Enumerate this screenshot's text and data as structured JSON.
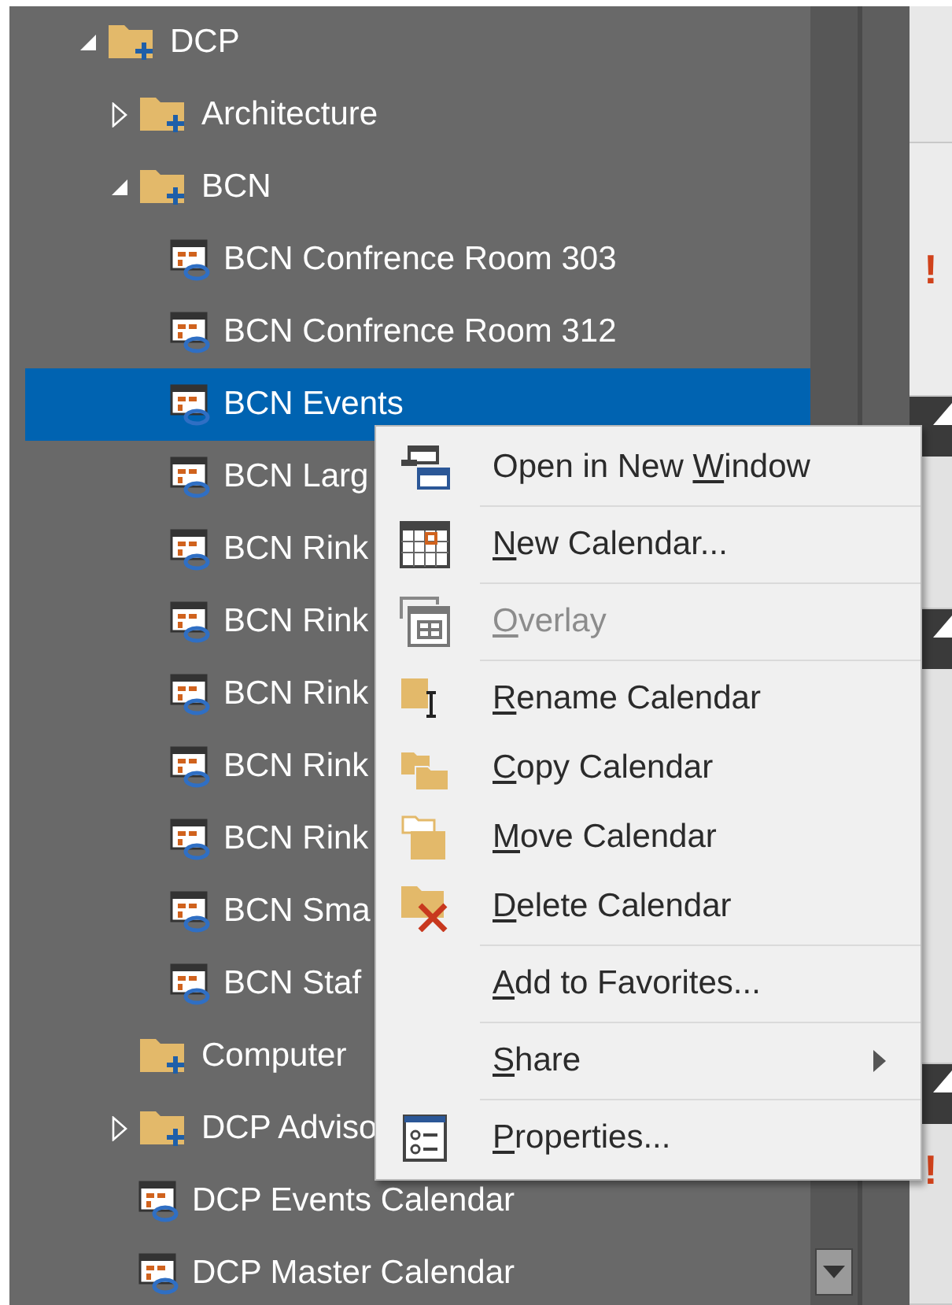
{
  "folder_tree": [
    {
      "label": "DCP",
      "kind": "folder",
      "expanded": true,
      "selected": false,
      "children": [
        {
          "label": "Architecture",
          "kind": "folder",
          "expanded": false,
          "selected": false
        },
        {
          "label": "BCN",
          "kind": "folder",
          "expanded": true,
          "selected": false,
          "children": [
            {
              "label": "BCN Confrence Room 303",
              "kind": "calendar",
              "selected": false
            },
            {
              "label": "BCN Confrence Room 312",
              "kind": "calendar",
              "selected": false
            },
            {
              "label": "BCN Events",
              "kind": "calendar",
              "selected": true
            },
            {
              "label": "BCN Larg",
              "kind": "calendar",
              "selected": false
            },
            {
              "label": "BCN Rink",
              "kind": "calendar",
              "selected": false
            },
            {
              "label": "BCN Rink",
              "kind": "calendar",
              "selected": false
            },
            {
              "label": "BCN Rink",
              "kind": "calendar",
              "selected": false
            },
            {
              "label": "BCN Rink",
              "kind": "calendar",
              "selected": false
            },
            {
              "label": "BCN Rink",
              "kind": "calendar",
              "selected": false
            },
            {
              "label": "BCN Sma",
              "kind": "calendar",
              "selected": false
            },
            {
              "label": "BCN Staf",
              "kind": "calendar",
              "selected": false
            }
          ]
        },
        {
          "label": "Computer",
          "kind": "folder",
          "selected": false
        },
        {
          "label": "DCP Adviso",
          "kind": "folder",
          "expanded": false,
          "selected": false
        },
        {
          "label": "DCP Events Calendar",
          "kind": "calendar",
          "selected": false
        },
        {
          "label": "DCP Master Calendar",
          "kind": "calendar",
          "selected": false
        }
      ]
    }
  ],
  "context_menu": [
    {
      "label": "Open in New Window",
      "kind": "window",
      "disabled": false,
      "submenu": false,
      "separator_after": true
    },
    {
      "label": "New Calendar...",
      "kind": "calendar",
      "disabled": false,
      "submenu": false,
      "separator_after": true
    },
    {
      "label": "Overlay",
      "kind": "overlay",
      "disabled": true,
      "submenu": false,
      "separator_after": true
    },
    {
      "label": "Rename Calendar",
      "kind": "rename",
      "disabled": false,
      "submenu": false,
      "separator_after": false
    },
    {
      "label": "Copy Calendar",
      "kind": "copy",
      "disabled": false,
      "submenu": false,
      "separator_after": false
    },
    {
      "label": "Move Calendar",
      "kind": "move",
      "disabled": false,
      "submenu": false,
      "separator_after": false
    },
    {
      "label": "Delete Calendar",
      "kind": "delete",
      "disabled": false,
      "submenu": false,
      "separator_after": true
    },
    {
      "label": "Add to Favorites...",
      "kind": "plain",
      "disabled": false,
      "submenu": false,
      "separator_after": true
    },
    {
      "label": "Share",
      "kind": "plain",
      "disabled": false,
      "submenu": true,
      "separator_after": true
    },
    {
      "label": "Properties...",
      "kind": "properties",
      "disabled": false,
      "submenu": false,
      "separator_after": false
    }
  ],
  "reading_pane": {
    "alerts": [
      "!",
      "!"
    ]
  }
}
